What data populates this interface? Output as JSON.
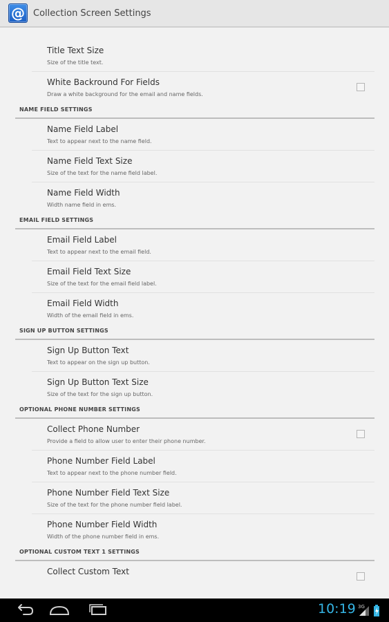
{
  "app": {
    "icon": "at-sign-icon",
    "icon_glyph": "@",
    "title": "Collection Screen Settings"
  },
  "groups": [
    {
      "header": "",
      "items": [
        {
          "title": "Title Text Size",
          "summary": "Size of the title text.",
          "checkbox": false
        },
        {
          "title": "White Backround For Fields",
          "summary": "Draw a white background for the email and name fields.",
          "checkbox": true,
          "checked": false
        }
      ]
    },
    {
      "header": "NAME FIELD SETTINGS",
      "items": [
        {
          "title": "Name Field Label",
          "summary": "Text to appear next to the name field.",
          "checkbox": false
        },
        {
          "title": "Name Field Text Size",
          "summary": "Size of the text for the name field label.",
          "checkbox": false
        },
        {
          "title": "Name Field Width",
          "summary": "Width name field in ems.",
          "checkbox": false
        }
      ]
    },
    {
      "header": "EMAIL FIELD SETTINGS",
      "items": [
        {
          "title": "Email Field Label",
          "summary": "Text to appear next to the email field.",
          "checkbox": false
        },
        {
          "title": "Email Field Text Size",
          "summary": "Size of the text for the email field label.",
          "checkbox": false
        },
        {
          "title": "Email Field Width",
          "summary": "Width of the email field in ems.",
          "checkbox": false
        }
      ]
    },
    {
      "header": "SIGN UP BUTTON SETTINGS",
      "items": [
        {
          "title": "Sign Up Button Text",
          "summary": "Text to appear on the sign up button.",
          "checkbox": false
        },
        {
          "title": "Sign Up Button Text Size",
          "summary": "Size of the text for the sign up button.",
          "checkbox": false
        }
      ]
    },
    {
      "header": "OPTIONAL PHONE NUMBER SETTINGS",
      "items": [
        {
          "title": "Collect Phone Number",
          "summary": "Provide a field to allow user to enter their phone number.",
          "checkbox": true,
          "checked": false
        },
        {
          "title": "Phone Number Field Label",
          "summary": "Text to appear next to the phone number field.",
          "checkbox": false
        },
        {
          "title": "Phone Number Field Text Size",
          "summary": "Size of the text for the phone number field label.",
          "checkbox": false
        },
        {
          "title": "Phone Number Field Width",
          "summary": "Width of the phone number field in ems.",
          "checkbox": false
        }
      ]
    },
    {
      "header": "OPTIONAL CUSTOM TEXT 1 SETTINGS",
      "items": [
        {
          "title": "Collect Custom Text",
          "summary": "",
          "checkbox": true,
          "checked": false
        }
      ]
    }
  ],
  "navbar": {
    "back_icon": "back-icon",
    "home_icon": "home-icon",
    "recents_icon": "recent-apps-icon",
    "time": "10:19",
    "network_label": "3G",
    "signal_icon": "signal-icon",
    "battery_icon": "battery-charging-icon",
    "accent": "#35b5e5"
  },
  "colors": {
    "background": "#f2f2f2",
    "app_icon_blue": "#2a73d8",
    "clock_blue": "#35b5e5"
  }
}
